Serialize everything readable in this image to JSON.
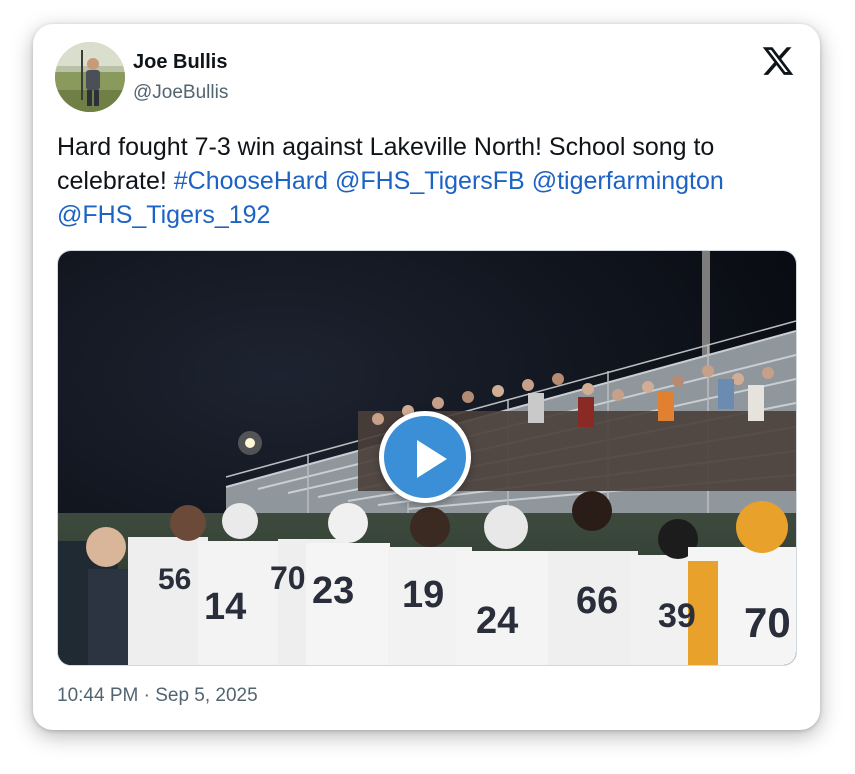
{
  "author": {
    "name": "Joe Bullis",
    "handle": "@JoeBullis"
  },
  "brand_icon": "x-logo-icon",
  "tweet": {
    "text_plain": "Hard fought 7-3 win against Lakeville North! School song to celebrate! ",
    "hashtag": "#ChooseHard",
    "mention_1": "@FHS_TigersFB",
    "mention_2": "@tigerfarmington",
    "mention_3": "@FHS_Tigers_192"
  },
  "media": {
    "type": "video",
    "play_icon": "play-icon",
    "jersey_numbers": [
      "56",
      "14",
      "70",
      "23",
      "19",
      "24",
      "66",
      "39",
      "70"
    ]
  },
  "timestamp": "10:44 PM · Sep 5, 2025",
  "colors": {
    "link": "#1d63c4",
    "text": "#0f1419",
    "secondary": "#536471",
    "play_button": "#3a8fd6"
  }
}
